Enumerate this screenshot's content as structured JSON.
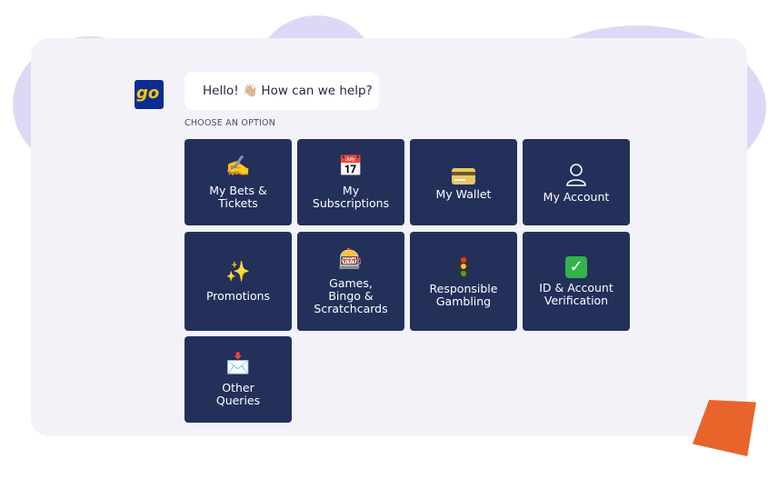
{
  "logo": {
    "text": "go"
  },
  "greeting": {
    "before": "Hello!",
    "emoji": "👋🏼",
    "after": "How can we help?"
  },
  "choose_label": "CHOOSE AN OPTION",
  "options": [
    {
      "label": "My Bets &\nTickets",
      "icon": "writing-hand-icon",
      "glyph": "✍️"
    },
    {
      "label": "My\nSubscriptions",
      "icon": "calendar-icon",
      "glyph": "📅"
    },
    {
      "label": "My Wallet",
      "icon": "credit-card-icon"
    },
    {
      "label": "My Account",
      "icon": "user-icon"
    },
    {
      "label": "Promotions",
      "icon": "sparkles-icon",
      "glyph": "✨"
    },
    {
      "label": "Games,\nBingo &\nScratchcards",
      "icon": "slot-machine-icon",
      "glyph": "🎰"
    },
    {
      "label": "Responsible\nGambling",
      "icon": "traffic-light-icon"
    },
    {
      "label": "ID & Account\nVerification",
      "icon": "check-mark-icon",
      "glyph": "✓"
    },
    {
      "label": "Other\nQueries",
      "icon": "envelope-icon",
      "glyph": "📩"
    }
  ],
  "colors": {
    "tile": "#23305a",
    "panel": "#f2f2f8",
    "accent_orange": "#e8642a",
    "logo_bg": "#0a2e8f",
    "logo_text": "#f6c21a"
  }
}
